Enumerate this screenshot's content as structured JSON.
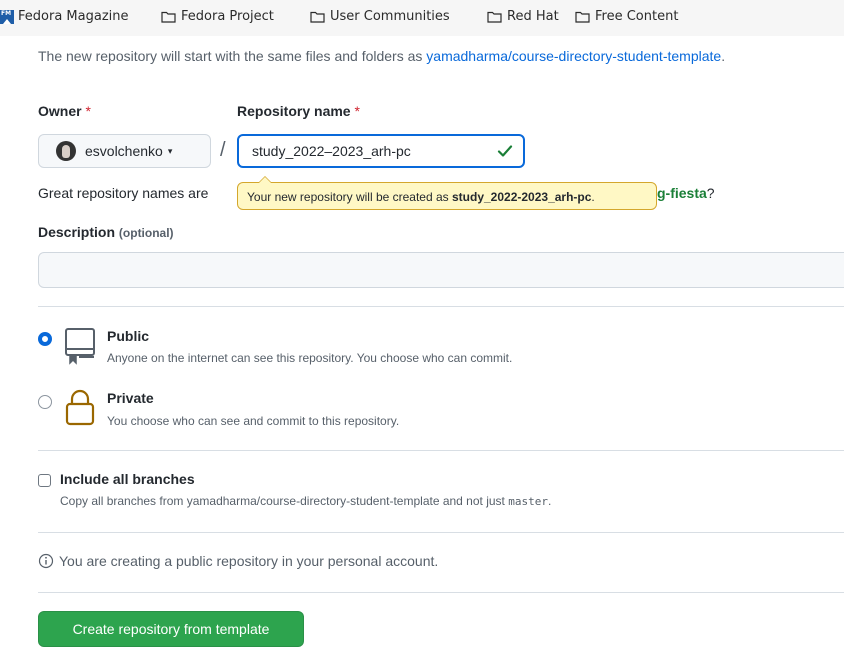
{
  "bookmarks": [
    {
      "label": "Fedora Magazine",
      "icon": "fedora-magazine-favicon"
    },
    {
      "label": "Fedora Project",
      "icon": "folder-icon"
    },
    {
      "label": "User Communities",
      "icon": "folder-icon"
    },
    {
      "label": "Red Hat",
      "icon": "folder-icon"
    },
    {
      "label": "Free Content",
      "icon": "folder-icon"
    }
  ],
  "favicon_text": "FM",
  "template": {
    "note_prefix": "The new repository will start with the same files and folders as ",
    "template_link": "yamadharma/course-directory-student-template",
    "note_suffix": "."
  },
  "owner": {
    "label": "Owner",
    "required_mark": "*",
    "selected": "esvolchenko",
    "caret": "▾"
  },
  "separator": "/",
  "repo_name": {
    "label": "Repository name",
    "required_mark": "*",
    "value": "study_2022–2023_arh-pc",
    "valid": true
  },
  "name_hint": {
    "prefix": "Great repository names are ",
    "suggestion": "g-fiesta",
    "suffix": "?"
  },
  "tooltip": {
    "prefix": "Your new repository will be created as ",
    "name": "study_2022-2023_arh-pc",
    "suffix": "."
  },
  "description": {
    "label": "Description",
    "optional": "(optional)",
    "value": ""
  },
  "visibility": {
    "selected": "public",
    "options": [
      {
        "id": "public",
        "title": "Public",
        "desc": "Anyone on the internet can see this repository. You choose who can commit.",
        "icon": "repo-icon"
      },
      {
        "id": "private",
        "title": "Private",
        "desc": "You choose who can see and commit to this repository.",
        "icon": "lock-icon"
      }
    ]
  },
  "branches": {
    "label": "Include all branches",
    "checked": false,
    "desc_prefix": "Copy all branches from yamadharma/course-directory-student-template and not just ",
    "desc_code": "master",
    "desc_suffix": "."
  },
  "info_text": "You are creating a public repository in your personal account.",
  "submit_label": "Create repository from template",
  "colors": {
    "accent": "#0969da",
    "primary_button": "#2da44e",
    "success": "#1a7f37",
    "danger": "#cf222e",
    "tooltip_bg": "#fff8c5",
    "lock_icon": "#9a6700"
  }
}
